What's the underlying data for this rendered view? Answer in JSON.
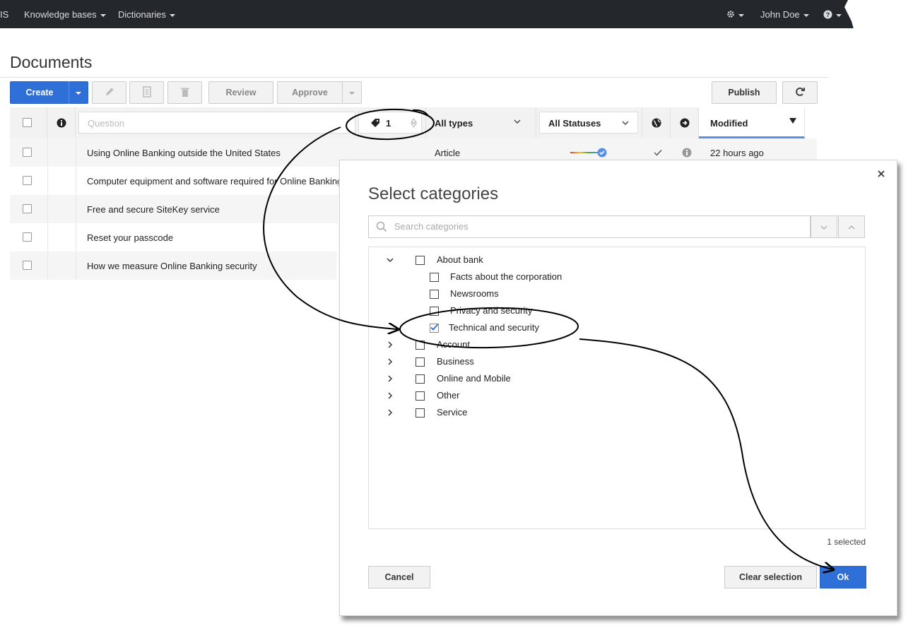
{
  "navbar": {
    "brand_fragment": "IS",
    "items": [
      "Knowledge bases",
      "Dictionaries"
    ],
    "user": "John Doe"
  },
  "page": {
    "title": "Documents"
  },
  "toolbar": {
    "create": "Create",
    "review": "Review",
    "approve": "Approve",
    "publish": "Publish"
  },
  "table": {
    "question_placeholder": "Question",
    "category_count": "1",
    "type_filter": "All types",
    "status_filter": "All Statuses",
    "modified_header": "Modified",
    "rows": [
      "Using Online Banking outside the United States",
      "Computer equipment and software required for Online Banking",
      "Free and secure SiteKey service",
      "Reset your passcode",
      "How we measure Online Banking security"
    ],
    "first_row": {
      "type": "Article",
      "modified": "22 hours ago"
    }
  },
  "dialog": {
    "title": "Select categories",
    "search_placeholder": "Search categories",
    "tree": [
      {
        "label": "About bank",
        "level": 0,
        "expanded": true,
        "checked": false
      },
      {
        "label": "Facts about the corporation",
        "level": 1,
        "checked": false
      },
      {
        "label": "Newsrooms",
        "level": 1,
        "checked": false
      },
      {
        "label": "Privacy and security",
        "level": 1,
        "checked": false
      },
      {
        "label": "Technical and security",
        "level": 1,
        "checked": true
      },
      {
        "label": "Account",
        "level": 0,
        "expanded": false,
        "checked": false
      },
      {
        "label": "Business",
        "level": 0,
        "expanded": false,
        "checked": false
      },
      {
        "label": "Online and Mobile",
        "level": 0,
        "expanded": false,
        "checked": false
      },
      {
        "label": "Other",
        "level": 0,
        "expanded": false,
        "checked": false
      },
      {
        "label": "Service",
        "level": 0,
        "expanded": false,
        "checked": false
      }
    ],
    "selected_count": "1 selected",
    "cancel": "Cancel",
    "clear": "Clear selection",
    "ok": "Ok"
  },
  "colors": {
    "primary": "#2e6fd8",
    "navbar": "#24272c",
    "check": "#2e6fd8"
  }
}
